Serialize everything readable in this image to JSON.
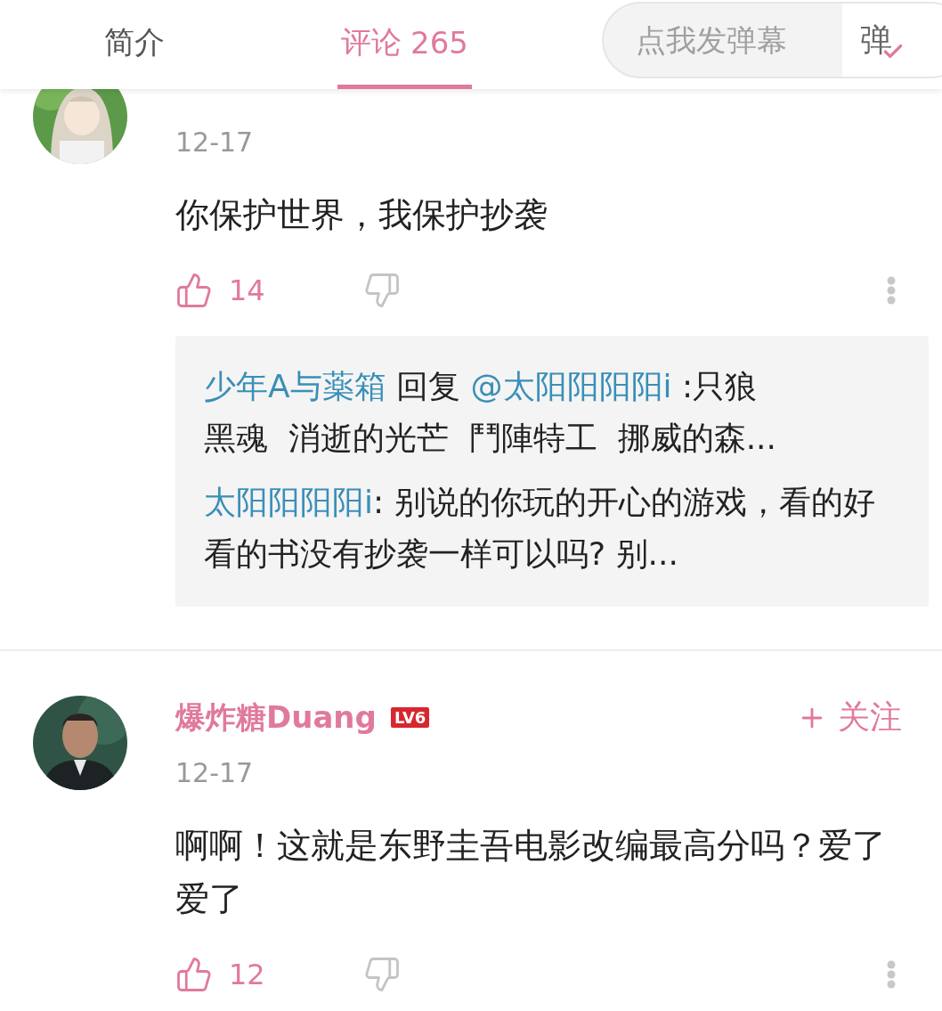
{
  "tabs": [
    {
      "label": "简介",
      "selected": false
    },
    {
      "label": "评论",
      "count": "265",
      "selected": true
    }
  ],
  "danmaku": {
    "placeholder": "点我发弹幕",
    "toggle_label": "弹",
    "toggle_on": true
  },
  "comments": [
    {
      "date": "12-17",
      "text": "你保护世界，我保护抄袭",
      "likes": "14",
      "liked": true,
      "replies": [
        {
          "author": "少年A与薬箱",
          "verb": "回复",
          "target": "@太阳阳阳阳i",
          "text": " :只狼黑魂  消逝的光芒  鬥陣特工  挪威的森..."
        },
        {
          "author": "太阳阳阳阳i",
          "text": ": 别说的你玩的开心的游戏，看的好看的书没有抄袭一样可以吗? 别..."
        }
      ]
    },
    {
      "author": "爆炸糖Duang",
      "level_badge": "LV6",
      "follow": "关注",
      "date": "12-17",
      "text": "啊啊！这就是东野圭吾电影改编最高分吗？爱了爱了",
      "likes": "12",
      "liked": true
    }
  ]
}
